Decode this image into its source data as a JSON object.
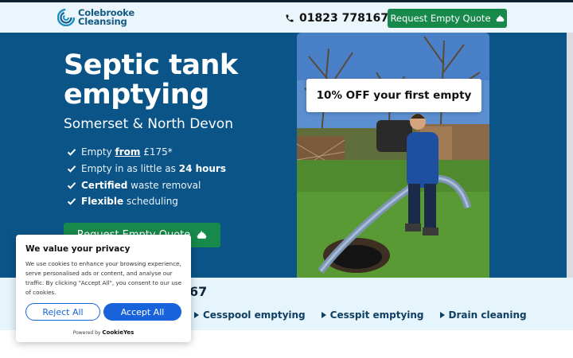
{
  "header": {
    "logo_line1": "Colebrooke",
    "logo_line2": "Cleansing",
    "phone": "01823 778167",
    "cta_label": "Request Empty Quote",
    "cta_icon": "poop-icon",
    "phone_icon": "phone-icon"
  },
  "hero": {
    "title_line1": "Septic tank",
    "title_line2": "emptying",
    "subtitle": "Somerset & North Devon",
    "benefits": [
      {
        "pre": "Empty ",
        "emph": "from",
        "post": " £175*"
      },
      {
        "pre": "Empty in as little as ",
        "emph": "24 hours",
        "post": ""
      },
      {
        "pre": "",
        "emph": "Certified",
        "post": " waste removal"
      },
      {
        "pre": "",
        "emph": "Flexible",
        "post": " scheduling"
      }
    ],
    "cta_label": "Request Empty Quote",
    "offer": "10% OFF your first empty"
  },
  "strip": {
    "phone_partial": "67",
    "services": [
      "Cesspool emptying",
      "Cesspit emptying",
      "Drain cleaning"
    ]
  },
  "cookie": {
    "title": "We value your privacy",
    "body": "We use cookies to enhance your browsing experience, serve personalised ads or content, and analyse our traffic. By clicking \"Accept All\", you consent to our use of cookies.",
    "reject_label": "Reject All",
    "accept_label": "Accept All",
    "powered_prefix": "Powered by",
    "powered_brand": "CookieYes"
  },
  "colors": {
    "brand_blue": "#0b5487",
    "cta_green": "#17894a",
    "cookie_blue": "#1863dc",
    "header_bg": "#eaf6fb"
  }
}
